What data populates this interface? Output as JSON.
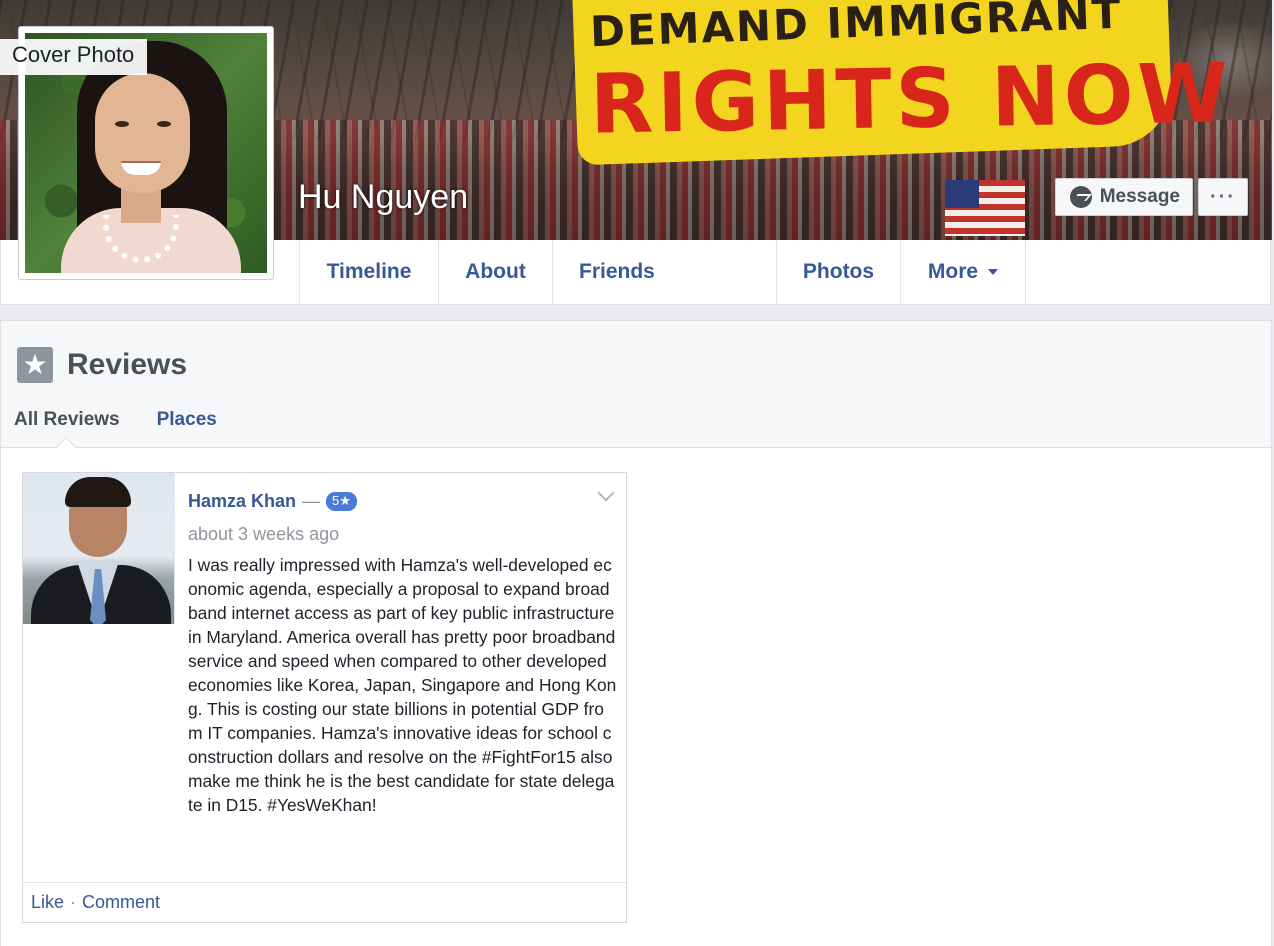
{
  "cover": {
    "label": "Cover Photo",
    "banner_line1": "DEMAND IMMIGRANT",
    "banner_line2": "RIGHTS NOW"
  },
  "profile": {
    "name": "Hu Nguyen"
  },
  "actions": {
    "message_label": "Message",
    "more_label": "···"
  },
  "nav": {
    "tabs": [
      {
        "label": "Timeline"
      },
      {
        "label": "About"
      },
      {
        "label": "Friends"
      },
      {
        "label": "Photos"
      },
      {
        "label": "More"
      }
    ]
  },
  "reviews": {
    "title": "Reviews",
    "tabs": [
      {
        "label": "All Reviews",
        "active": true
      },
      {
        "label": "Places",
        "active": false
      }
    ],
    "items": [
      {
        "author": "Hamza Khan",
        "separator": "—",
        "rating": "5★",
        "time": "about 3 weeks ago",
        "text": "I was really impressed with Hamza's well-developed economic agenda, especially a proposal to expand broadband internet access as part of key public infrastructure in Maryland. America overall has pretty poor broadband service and speed when compared to other developed economies like Korea, Japan, Singapore and Hong Kong. This is costing our state billions in potential GDP from IT companies. Hamza's innovative ideas for school construction dollars and resolve on the #FightFor15 also make me think he is the best candidate for state delegate in D15. #YesWeKhan!",
        "like_label": "Like",
        "dot": "·",
        "comment_label": "Comment"
      }
    ]
  },
  "colors": {
    "link": "#385898",
    "muted": "#90949c",
    "rating_badge": "#4a7bd8",
    "page_bg": "#e9ebee"
  }
}
